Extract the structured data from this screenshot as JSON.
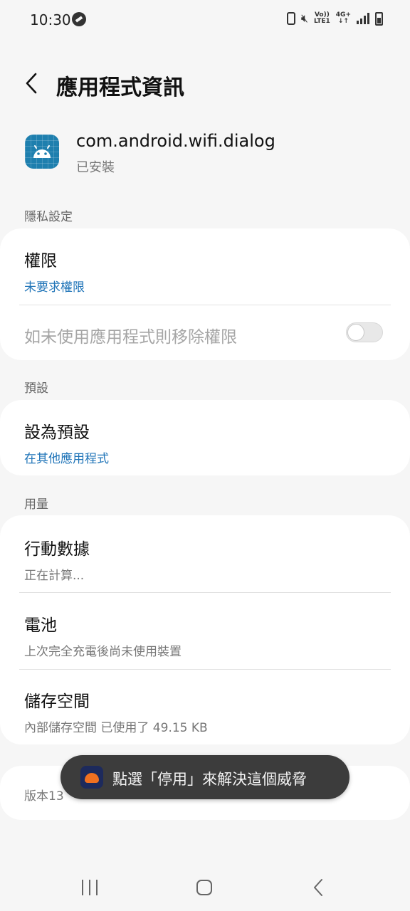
{
  "status_bar": {
    "time": "10:30",
    "volte_label": "Vo))\nLTE1",
    "network_label": "4G+\n↓↑"
  },
  "header": {
    "title": "應用程式資訊"
  },
  "app": {
    "name": "com.android.wifi.dialog",
    "status": "已安裝"
  },
  "sections": {
    "privacy": {
      "label": "隱私設定",
      "permissions_title": "權限",
      "permissions_value": "未要求權限",
      "remove_permissions_label": "如未使用應用程式則移除權限",
      "remove_permissions_enabled": false
    },
    "defaults": {
      "label": "預設",
      "set_default_title": "設為預設",
      "set_default_value": "在其他應用程式"
    },
    "usage": {
      "label": "用量",
      "mobile_data_title": "行動數據",
      "mobile_data_value": "正在計算...",
      "battery_title": "電池",
      "battery_value": "上次完全充電後尚未使用裝置",
      "storage_title": "儲存空間",
      "storage_value": "內部儲存空間 已使用了 49.15 KB"
    },
    "version": {
      "text": "版本13"
    }
  },
  "toast": {
    "message": "點選「停用」來解決這個威脅"
  },
  "colors": {
    "accent": "#1f74b8",
    "background": "#f6f6f6",
    "card": "#ffffff",
    "toast_bg": "#3c3c3c",
    "app_icon": "#1e7fae"
  }
}
